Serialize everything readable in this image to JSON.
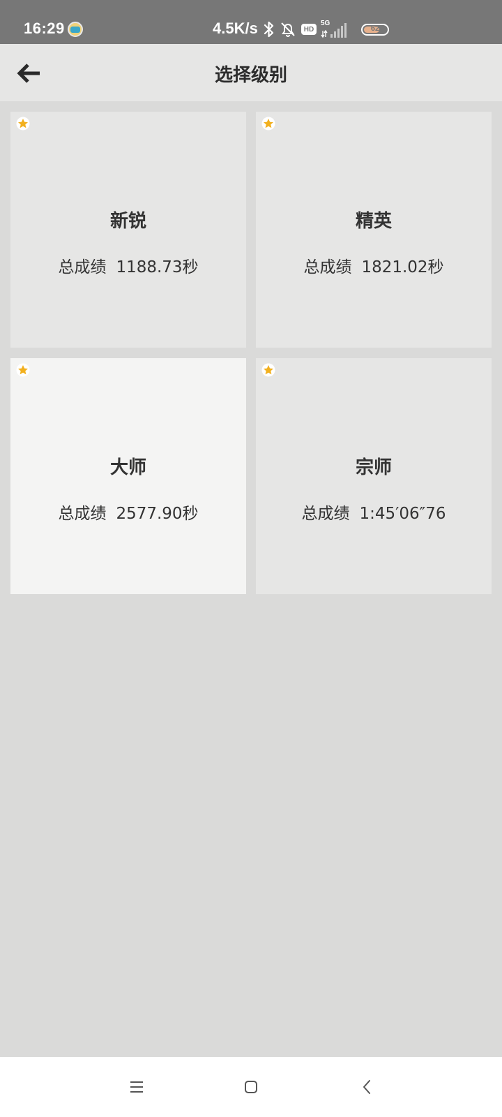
{
  "status_bar": {
    "time": "16:29",
    "net_speed": "4.5K/s",
    "network_type": "5G",
    "hd_label": "HD",
    "battery_level": "62",
    "icons": [
      "app-notification-icon",
      "bluetooth-icon",
      "notifications-off-icon",
      "hd-voice-icon",
      "signal-icon",
      "battery-icon"
    ]
  },
  "app_bar": {
    "back_icon": "arrow-left-icon",
    "title": "选择级别"
  },
  "levels": [
    {
      "name": "新锐",
      "score_label": "总成绩",
      "score": "1188.73秒",
      "starred": true,
      "selected": false
    },
    {
      "name": "精英",
      "score_label": "总成绩",
      "score": "1821.02秒",
      "starred": true,
      "selected": false
    },
    {
      "name": "大师",
      "score_label": "总成绩",
      "score": "2577.90秒",
      "starred": true,
      "selected": true
    },
    {
      "name": "宗师",
      "score_label": "总成绩",
      "score": "1:45′06″76",
      "starred": true,
      "selected": false
    }
  ],
  "nav_bar": {
    "icons": [
      "menu-icon",
      "home-square-icon",
      "back-chevron-icon"
    ]
  },
  "colors": {
    "star": "#f2b01e",
    "background": "#dadad9",
    "card": "#e6e6e5",
    "card_selected": "#f4f4f3"
  }
}
